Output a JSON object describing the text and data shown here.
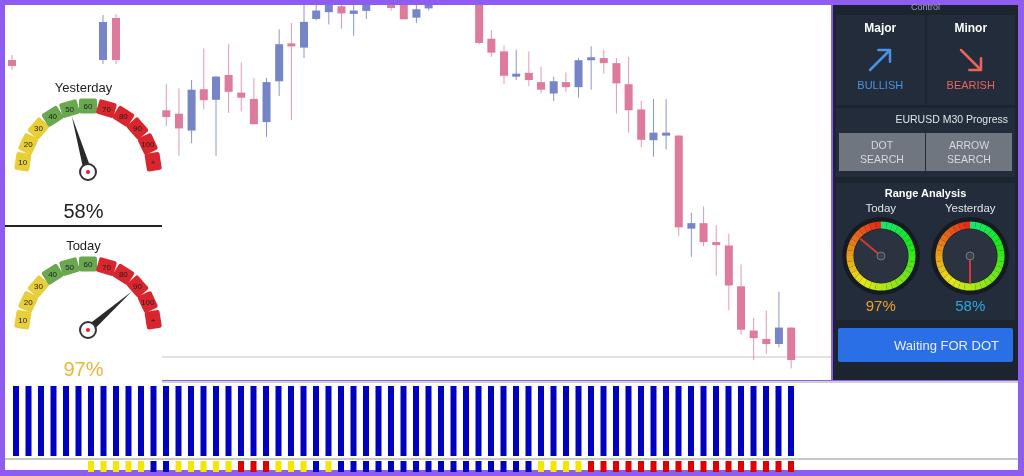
{
  "left_gauges": [
    {
      "title": "Yesterday",
      "reading": "58%",
      "color": "#222222",
      "scale": [
        {
          "label": "10",
          "color": "#e8cf3a"
        },
        {
          "label": "20",
          "color": "#e8cf3a"
        },
        {
          "label": "30",
          "color": "#e8cf3a"
        },
        {
          "label": "40",
          "color": "#6aa84f"
        },
        {
          "label": "50",
          "color": "#6aa84f"
        },
        {
          "label": "60",
          "color": "#6aa84f"
        },
        {
          "label": "70",
          "color": "#d9262e"
        },
        {
          "label": "80",
          "color": "#d9262e"
        },
        {
          "label": "90",
          "color": "#d9262e"
        },
        {
          "label": "100",
          "color": "#d9262e"
        },
        {
          "label": "+",
          "color": "#d9262e"
        }
      ]
    },
    {
      "title": "Today",
      "reading": "97%",
      "color": "#f0b43c",
      "scale": [
        {
          "label": "10",
          "color": "#e8cf3a"
        },
        {
          "label": "20",
          "color": "#e8cf3a"
        },
        {
          "label": "30",
          "color": "#e8cf3a"
        },
        {
          "label": "40",
          "color": "#6aa84f"
        },
        {
          "label": "50",
          "color": "#6aa84f"
        },
        {
          "label": "60",
          "color": "#6aa84f"
        },
        {
          "label": "70",
          "color": "#d9262e"
        },
        {
          "label": "80",
          "color": "#d9262e"
        },
        {
          "label": "90",
          "color": "#d9262e"
        },
        {
          "label": "100",
          "color": "#d9262e"
        },
        {
          "label": "+",
          "color": "#d9262e"
        }
      ]
    }
  ],
  "control_panel": {
    "header": "Control",
    "trends": [
      {
        "title": "Major",
        "kind": "bullish",
        "label": "BULLISH"
      },
      {
        "title": "Minor",
        "kind": "bearish",
        "label": "BEARISH"
      }
    ],
    "progress_title": "EURUSD M30 Progress",
    "buttons": [
      "DOT SEARCH",
      "ARROW SEARCH"
    ],
    "range_analysis": {
      "title": "Range Analysis",
      "gauges": [
        {
          "label": "Today",
          "reading": "97%",
          "color": "#f0a326"
        },
        {
          "label": "Yesterday",
          "reading": "58%",
          "color": "#2fa8df"
        }
      ]
    },
    "status_button": "Waiting FOR DOT"
  },
  "indicator": {
    "signal_bars": [
      {
        "color": "#f5e600"
      },
      {
        "color": "#f5e600"
      },
      {
        "color": "#f5e600"
      },
      {
        "color": "#f5e600"
      },
      {
        "color": "#f5e600"
      },
      {
        "color": "#0000c0"
      },
      {
        "color": "#0000c0"
      },
      {
        "color": "#f5e600"
      },
      {
        "color": "#f5e600"
      },
      {
        "color": "#f5e600"
      },
      {
        "color": "#f5e600"
      },
      {
        "color": "#f5e600"
      },
      {
        "color": "#e00000"
      },
      {
        "color": "#e00000"
      },
      {
        "color": "#e00000"
      },
      {
        "color": "#f5e600"
      },
      {
        "color": "#f5e600"
      },
      {
        "color": "#f5e600"
      },
      {
        "color": "#0000c0"
      },
      {
        "color": "#f5e600"
      },
      {
        "color": "#0000c0"
      },
      {
        "color": "#0000c0"
      },
      {
        "color": "#0000c0"
      },
      {
        "color": "#0000c0"
      },
      {
        "color": "#0000c0"
      },
      {
        "color": "#0000c0"
      },
      {
        "color": "#0000c0"
      },
      {
        "color": "#0000c0"
      },
      {
        "color": "#0000c0"
      },
      {
        "color": "#0000c0"
      },
      {
        "color": "#0000c0"
      },
      {
        "color": "#0000c0"
      },
      {
        "color": "#0000c0"
      },
      {
        "color": "#0000c0"
      },
      {
        "color": "#0000c0"
      },
      {
        "color": "#0000c0"
      },
      {
        "color": "#f5e600"
      },
      {
        "color": "#f5e600"
      },
      {
        "color": "#f5e600"
      },
      {
        "color": "#f5e600"
      },
      {
        "color": "#e00000"
      },
      {
        "color": "#e00000"
      },
      {
        "color": "#e00000"
      },
      {
        "color": "#e00000"
      },
      {
        "color": "#e00000"
      },
      {
        "color": "#e00000"
      },
      {
        "color": "#e00000"
      },
      {
        "color": "#e00000"
      },
      {
        "color": "#e00000"
      },
      {
        "color": "#e00000"
      },
      {
        "color": "#e00000"
      },
      {
        "color": "#e00000"
      },
      {
        "color": "#e00000"
      },
      {
        "color": "#e00000"
      },
      {
        "color": "#e00000"
      },
      {
        "color": "#e00000"
      },
      {
        "color": "#e00000"
      }
    ]
  }
}
